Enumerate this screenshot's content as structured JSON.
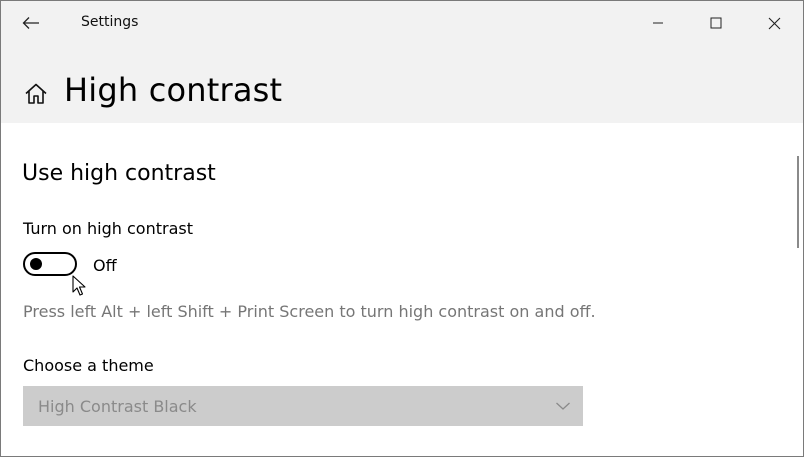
{
  "window": {
    "title": "Settings"
  },
  "header": {
    "title": "High contrast"
  },
  "section": {
    "title": "Use high contrast"
  },
  "toggle": {
    "label": "Turn on high contrast",
    "state_label": "Off",
    "on": false
  },
  "hint": {
    "text": "Press left Alt + left Shift + Print Screen to turn high contrast on and off."
  },
  "theme": {
    "label": "Choose a theme",
    "selected": "High Contrast Black",
    "disabled": true
  },
  "icons": {
    "back": "back-arrow-icon",
    "home": "home-icon",
    "minimize": "minimize-icon",
    "maximize": "maximize-icon",
    "close": "close-icon",
    "chevron": "chevron-down-icon"
  },
  "colors": {
    "chrome_bg": "#f2f2f2",
    "content_bg": "#ffffff",
    "hint_text": "#767676",
    "disabled_select_bg": "#cccccc",
    "disabled_select_text": "#8a8a8a"
  }
}
